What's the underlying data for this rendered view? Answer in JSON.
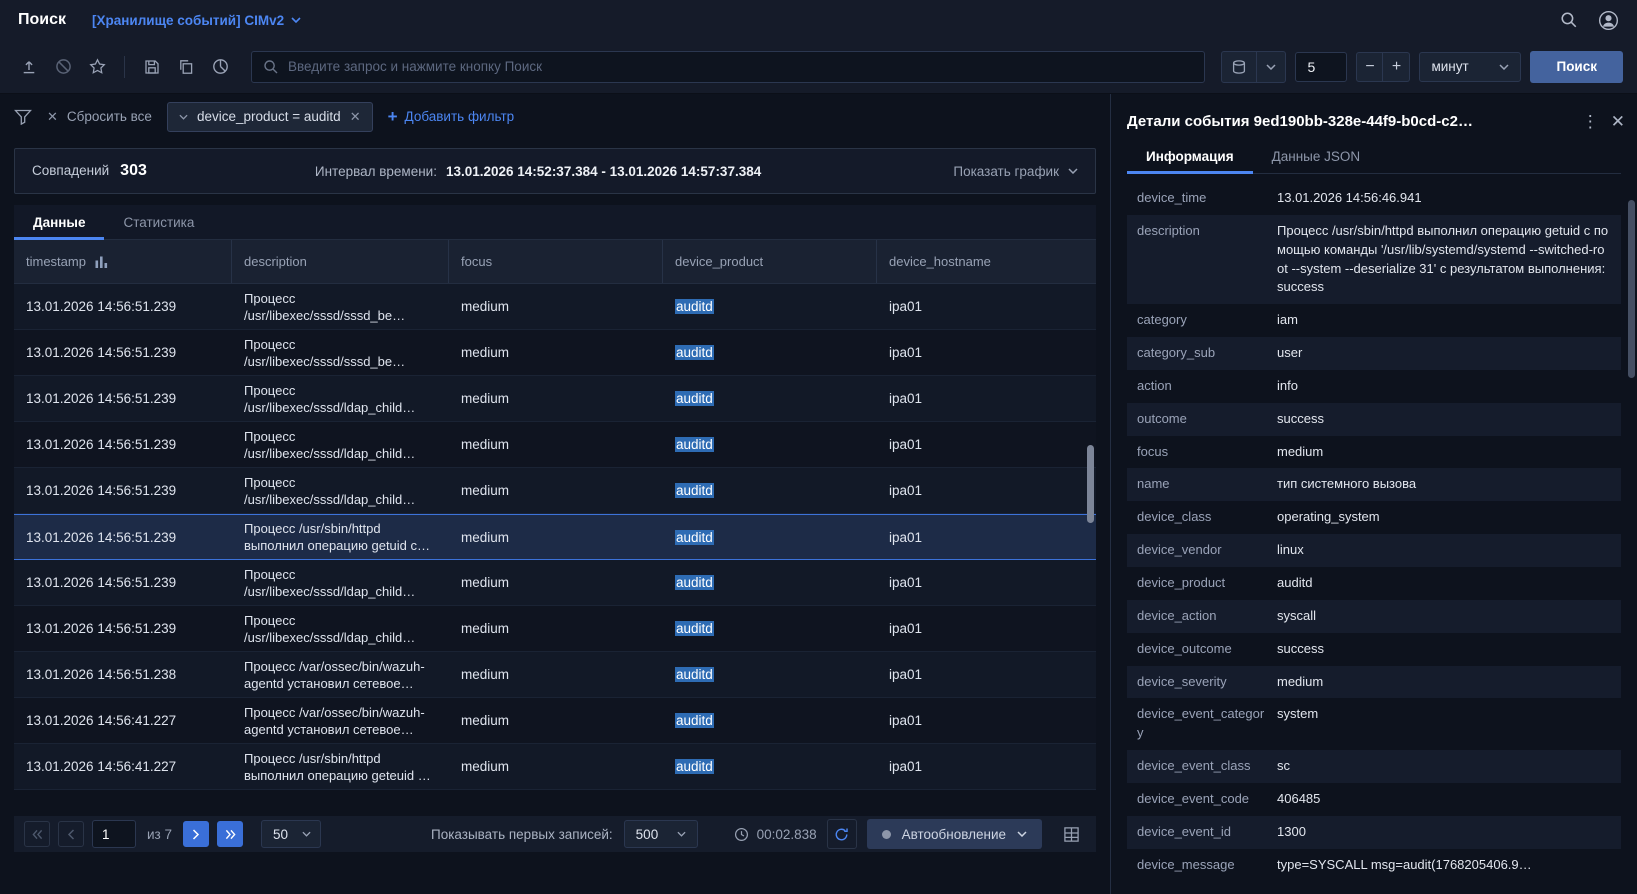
{
  "colors": {
    "accent": "#4c86f2",
    "match_highlight": "#2e6cb4"
  },
  "header": {
    "title": "Поиск",
    "storage": "[Хранилище событий] CIMv2"
  },
  "toolbar": {
    "search_placeholder": "Введите запрос и нажмите кнопку Поиск",
    "interval_value": "5",
    "interval_unit": "минут",
    "search_button": "Поиск"
  },
  "filters": {
    "clear_all": "Сбросить все",
    "chip": "device_product = auditd",
    "add_filter": "Добавить фильтр"
  },
  "summary": {
    "matches_label": "Совпадений",
    "matches_count": "303",
    "interval_label": "Интервал времени:",
    "interval_value": "13.01.2026 14:52:37.384 - 13.01.2026 14:57:37.384",
    "show_chart": "Показать график"
  },
  "result_tabs": {
    "data": "Данные",
    "stats": "Статистика"
  },
  "table": {
    "columns": [
      "timestamp",
      "description",
      "focus",
      "device_product",
      "device_hostname"
    ],
    "rows": [
      {
        "timestamp": "13.01.2026 14:56:51.239",
        "description": "Процесс /usr/libexec/sssd/sssd_be…",
        "focus": "medium",
        "device_product": "auditd",
        "device_hostname": "ipa01"
      },
      {
        "timestamp": "13.01.2026 14:56:51.239",
        "description": "Процесс /usr/libexec/sssd/sssd_be…",
        "focus": "medium",
        "device_product": "auditd",
        "device_hostname": "ipa01"
      },
      {
        "timestamp": "13.01.2026 14:56:51.239",
        "description": "Процесс /usr/libexec/sssd/ldap_child…",
        "focus": "medium",
        "device_product": "auditd",
        "device_hostname": "ipa01"
      },
      {
        "timestamp": "13.01.2026 14:56:51.239",
        "description": "Процесс /usr/libexec/sssd/ldap_child…",
        "focus": "medium",
        "device_product": "auditd",
        "device_hostname": "ipa01"
      },
      {
        "timestamp": "13.01.2026 14:56:51.239",
        "description": "Процесс /usr/libexec/sssd/ldap_child…",
        "focus": "medium",
        "device_product": "auditd",
        "device_hostname": "ipa01"
      },
      {
        "timestamp": "13.01.2026 14:56:51.239",
        "description": "Процесс /usr/sbin/httpd выполнил операцию getuid с…",
        "focus": "medium",
        "device_product": "auditd",
        "device_hostname": "ipa01",
        "selected": true
      },
      {
        "timestamp": "13.01.2026 14:56:51.239",
        "description": "Процесс /usr/libexec/sssd/ldap_child…",
        "focus": "medium",
        "device_product": "auditd",
        "device_hostname": "ipa01"
      },
      {
        "timestamp": "13.01.2026 14:56:51.239",
        "description": "Процесс /usr/libexec/sssd/ldap_child…",
        "focus": "medium",
        "device_product": "auditd",
        "device_hostname": "ipa01"
      },
      {
        "timestamp": "13.01.2026 14:56:51.238",
        "description": "Процесс /var/ossec/bin/wazuh-agentd установил сетевое…",
        "focus": "medium",
        "device_product": "auditd",
        "device_hostname": "ipa01"
      },
      {
        "timestamp": "13.01.2026 14:56:41.227",
        "description": "Процесс /var/ossec/bin/wazuh-agentd установил сетевое…",
        "focus": "medium",
        "device_product": "auditd",
        "device_hostname": "ipa01"
      },
      {
        "timestamp": "13.01.2026 14:56:41.227",
        "description": "Процесс /usr/sbin/httpd выполнил операцию geteuid …",
        "focus": "medium",
        "device_product": "auditd",
        "device_hostname": "ipa01"
      }
    ]
  },
  "pagination": {
    "page": "1",
    "of": "из 7",
    "page_size": "50",
    "show_first_label": "Показывать первых записей:",
    "show_first_value": "500",
    "elapsed": "00:02.838",
    "autorefresh": "Автообновление"
  },
  "details": {
    "title": "Детали события 9ed190bb-328e-44f9-b0cd-c2…",
    "tab_info": "Информация",
    "tab_json": "Данные JSON",
    "fields": [
      {
        "key": "device_time",
        "value": "13.01.2026 14:56:46.941"
      },
      {
        "key": "description",
        "value": "Процесс /usr/sbin/httpd выполнил операцию getuid с помощью команды '/usr/lib/systemd/systemd --switched-root --system --deserialize 31' с результатом выполнения: success"
      },
      {
        "key": "category",
        "value": "iam"
      },
      {
        "key": "category_sub",
        "value": "user"
      },
      {
        "key": "action",
        "value": "info"
      },
      {
        "key": "outcome",
        "value": "success"
      },
      {
        "key": "focus",
        "value": "medium"
      },
      {
        "key": "name",
        "value": "тип системного вызова"
      },
      {
        "key": "device_class",
        "value": "operating_system"
      },
      {
        "key": "device_vendor",
        "value": "linux"
      },
      {
        "key": "device_product",
        "value": "auditd"
      },
      {
        "key": "device_action",
        "value": "syscall"
      },
      {
        "key": "device_outcome",
        "value": "success"
      },
      {
        "key": "device_severity",
        "value": "medium"
      },
      {
        "key": "device_event_category",
        "value": "system"
      },
      {
        "key": "device_event_class",
        "value": "sc"
      },
      {
        "key": "device_event_code",
        "value": "406485"
      },
      {
        "key": "device_event_id",
        "value": "1300"
      },
      {
        "key": "device_message",
        "value": "type=SYSCALL msg=audit(1768205406.9…"
      }
    ]
  }
}
